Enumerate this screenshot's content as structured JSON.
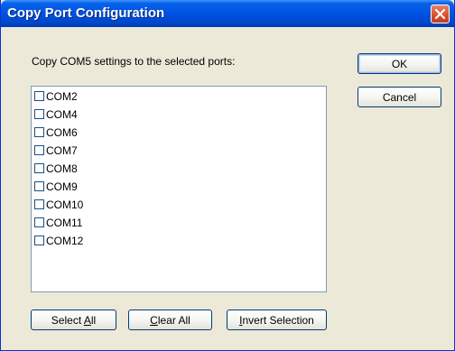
{
  "dialog": {
    "title": "Copy Port Configuration",
    "instruction": "Copy COM5 settings to the selected ports:"
  },
  "ports": [
    {
      "label": "COM2",
      "checked": false
    },
    {
      "label": "COM4",
      "checked": false
    },
    {
      "label": "COM6",
      "checked": false
    },
    {
      "label": "COM7",
      "checked": false
    },
    {
      "label": "COM8",
      "checked": false
    },
    {
      "label": "COM9",
      "checked": false
    },
    {
      "label": "COM10",
      "checked": false
    },
    {
      "label": "COM11",
      "checked": false
    },
    {
      "label": "COM12",
      "checked": false
    }
  ],
  "buttons": {
    "ok": "OK",
    "cancel": "Cancel",
    "select_all": {
      "pre": "Select ",
      "key": "A",
      "post": "ll"
    },
    "clear_all": {
      "pre": "",
      "key": "C",
      "post": "lear All"
    },
    "invert_selection": {
      "pre": "",
      "key": "I",
      "post": "nvert Selection"
    }
  },
  "colors": {
    "titlebar": "#0055e5",
    "window_bg": "#ece9d8",
    "close_button": "#d9532f"
  },
  "icons": {
    "close": "close-x-icon"
  }
}
